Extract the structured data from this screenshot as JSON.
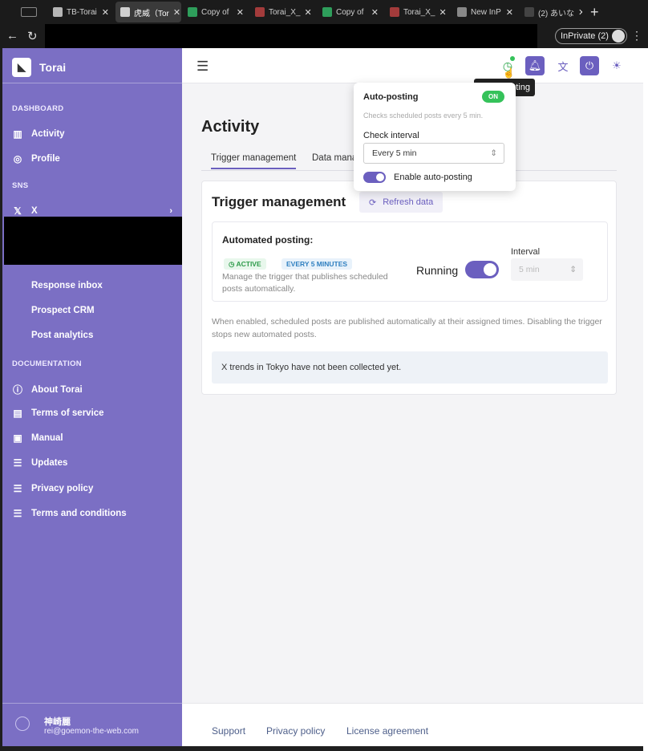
{
  "browser": {
    "tabs": [
      {
        "label": "TB-Torai",
        "fav": "#b6b6b6"
      },
      {
        "label": "虎威（Tor",
        "fav": "#d0d0d0",
        "active": true
      },
      {
        "label": "Copy of",
        "fav": "#2e9e5b"
      },
      {
        "label": "Torai_X_",
        "fav": "#a33b3b"
      },
      {
        "label": "Copy of",
        "fav": "#2e9e5b"
      },
      {
        "label": "Torai_X_",
        "fav": "#a33b3b"
      },
      {
        "label": "New InP",
        "fav": "#888888"
      },
      {
        "label": "(2) あいな",
        "fav": "#444444"
      }
    ],
    "inprivate_label": "InPrivate (2)"
  },
  "sidebar": {
    "brand": "Torai",
    "sections": {
      "dashboard": "DASHBOARD",
      "sns": "SNS",
      "documentation": "DOCUMENTATION"
    },
    "dashboard_items": [
      "Activity",
      "Profile"
    ],
    "sns_items": [
      "X"
    ],
    "sub_items": [
      "Response inbox",
      "Prospect CRM",
      "Post analytics"
    ],
    "doc_items": [
      "About Torai",
      "Terms of service",
      "Manual",
      "Updates",
      "Privacy policy",
      "Terms and conditions"
    ],
    "user": {
      "name": "神崎麗",
      "email": "rei@goemon-the-web.com"
    }
  },
  "topbar": {
    "tooltip": "ting"
  },
  "main": {
    "title": "Activity",
    "tabs": [
      "Trigger management",
      "Data mana"
    ],
    "card": {
      "title": "Trigger management",
      "refresh_label": "Refresh data",
      "automated_heading": "Automated posting:",
      "badge_active": "ACTIVE",
      "badge_every": "EVERY 5 MINUTES",
      "description": "Manage the trigger that publishes scheduled posts automatically.",
      "running_label": "Running",
      "interval_label": "Interval",
      "interval_value": "5 min",
      "note": "When enabled, scheduled posts are published automatically at their assigned times. Disabling the trigger stops new automated posts.",
      "info": "X trends in Tokyo have not been collected yet."
    },
    "footer": [
      "Support",
      "Privacy policy",
      "License agreement"
    ]
  },
  "popover": {
    "title": "Auto-posting",
    "status": "ON",
    "subtitle": "Checks scheduled posts every 5 min.",
    "check_interval_label": "Check interval",
    "check_interval_value": "Every 5 min",
    "enable_label": "Enable auto-posting"
  },
  "colors": {
    "sidebar": "#7b6fc4",
    "accent": "#6b5fbf",
    "on": "#35c25a"
  }
}
